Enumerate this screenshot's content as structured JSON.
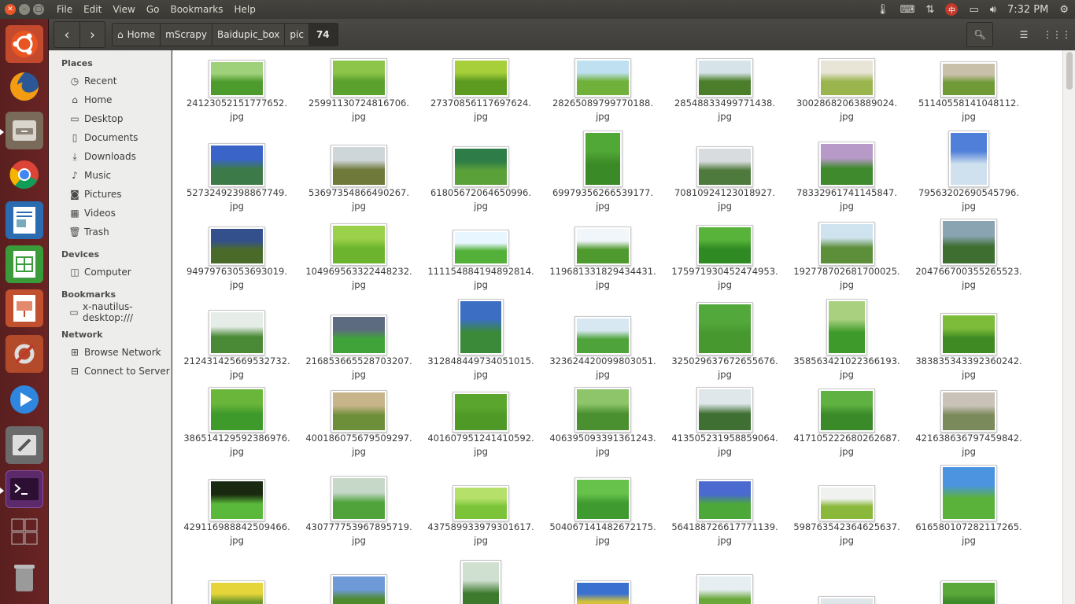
{
  "window": {
    "menus": [
      "File",
      "Edit",
      "View",
      "Go",
      "Bookmarks",
      "Help"
    ]
  },
  "panel": {
    "time": "7:32 PM"
  },
  "toolbar": {
    "breadcrumbs": [
      "Home",
      "mScrapy",
      "Baidupic_box",
      "pic",
      "74"
    ]
  },
  "sidebar": {
    "places_label": "Places",
    "places": [
      {
        "label": "Recent",
        "icon": "clock-icon"
      },
      {
        "label": "Home",
        "icon": "home-icon"
      },
      {
        "label": "Desktop",
        "icon": "folder-icon"
      },
      {
        "label": "Documents",
        "icon": "document-icon"
      },
      {
        "label": "Downloads",
        "icon": "download-icon"
      },
      {
        "label": "Music",
        "icon": "music-icon"
      },
      {
        "label": "Pictures",
        "icon": "camera-icon"
      },
      {
        "label": "Videos",
        "icon": "film-icon"
      },
      {
        "label": "Trash",
        "icon": "trash-icon"
      }
    ],
    "devices_label": "Devices",
    "devices": [
      {
        "label": "Computer",
        "icon": "drive-icon"
      }
    ],
    "bookmarks_label": "Bookmarks",
    "bookmarks": [
      {
        "label": "x-nautilus-desktop:///",
        "icon": "folder-icon"
      }
    ],
    "network_label": "Network",
    "network": [
      {
        "label": "Browse Network",
        "icon": "network-icon"
      },
      {
        "label": "Connect to Server",
        "icon": "server-icon"
      }
    ]
  },
  "files": [
    {
      "line1": "24123052151777652.",
      "line2": "jpg"
    },
    {
      "line1": "25991130724816706.",
      "line2": "jpg"
    },
    {
      "line1": "27370856117697624.",
      "line2": "jpg"
    },
    {
      "line1": "28265089799770188.",
      "line2": "jpg"
    },
    {
      "line1": "28548833499771438.",
      "line2": "jpg"
    },
    {
      "line1": "30028682063889024.",
      "line2": "jpg"
    },
    {
      "line1": "51140558141048112.",
      "line2": "jpg"
    },
    {
      "line1": "52732492398867749.",
      "line2": "jpg"
    },
    {
      "line1": "53697354866490267.",
      "line2": "jpg"
    },
    {
      "line1": "61805672064650996.",
      "line2": "jpg"
    },
    {
      "line1": "69979356266539177.",
      "line2": "jpg"
    },
    {
      "line1": "70810924123018927.",
      "line2": "jpg"
    },
    {
      "line1": "78332961741145847.",
      "line2": "jpg"
    },
    {
      "line1": "79563202690545796.",
      "line2": "jpg"
    },
    {
      "line1": "94979763053693019.",
      "line2": "jpg"
    },
    {
      "line1": "104969563322448232.",
      "line2": "jpg"
    },
    {
      "line1": "111154884194892814.",
      "line2": "jpg"
    },
    {
      "line1": "119681331829434431.",
      "line2": "jpg"
    },
    {
      "line1": "175971930452474953.",
      "line2": "jpg"
    },
    {
      "line1": "192778702681700025.",
      "line2": "jpg"
    },
    {
      "line1": "204766700355265523.",
      "line2": "jpg"
    },
    {
      "line1": "212431425669532732.",
      "line2": "jpg"
    },
    {
      "line1": "216853665528703207.",
      "line2": "jpg"
    },
    {
      "line1": "312848449734051015.",
      "line2": "jpg"
    },
    {
      "line1": "323624420099803051.",
      "line2": "jpg"
    },
    {
      "line1": "325029637672655676.",
      "line2": "jpg"
    },
    {
      "line1": "358563421022366193.",
      "line2": "jpg"
    },
    {
      "line1": "383835343392360242.",
      "line2": "jpg"
    },
    {
      "line1": "386514129592386976.",
      "line2": "jpg"
    },
    {
      "line1": "400186075679509297.",
      "line2": "jpg"
    },
    {
      "line1": "401607951241410592.",
      "line2": "jpg"
    },
    {
      "line1": "406395093391361243.",
      "line2": "jpg"
    },
    {
      "line1": "413505231958859064.",
      "line2": "jpg"
    },
    {
      "line1": "417105222680262687.",
      "line2": "jpg"
    },
    {
      "line1": "421638636797459842.",
      "line2": "jpg"
    },
    {
      "line1": "429116988842509466.",
      "line2": "jpg"
    },
    {
      "line1": "430777753967895719.",
      "line2": "jpg"
    },
    {
      "line1": "437589933979301617.",
      "line2": "jpg"
    },
    {
      "line1": "504067141482672175.",
      "line2": "jpg"
    },
    {
      "line1": "564188726617771139.",
      "line2": "jpg"
    },
    {
      "line1": "598763542364625637.",
      "line2": "jpg"
    },
    {
      "line1": "616580107282117265.",
      "line2": "jpg"
    },
    {
      "line1": "",
      "line2": ""
    },
    {
      "line1": "",
      "line2": ""
    },
    {
      "line1": "",
      "line2": ""
    },
    {
      "line1": "",
      "line2": ""
    },
    {
      "line1": "",
      "line2": ""
    },
    {
      "line1": "",
      "line2": ""
    },
    {
      "line1": "",
      "line2": ""
    }
  ],
  "colors": {
    "ubuntu_orange": "#e95420",
    "launcher_bg": "#5a1f1f",
    "grass_green": "#4fa83a"
  }
}
